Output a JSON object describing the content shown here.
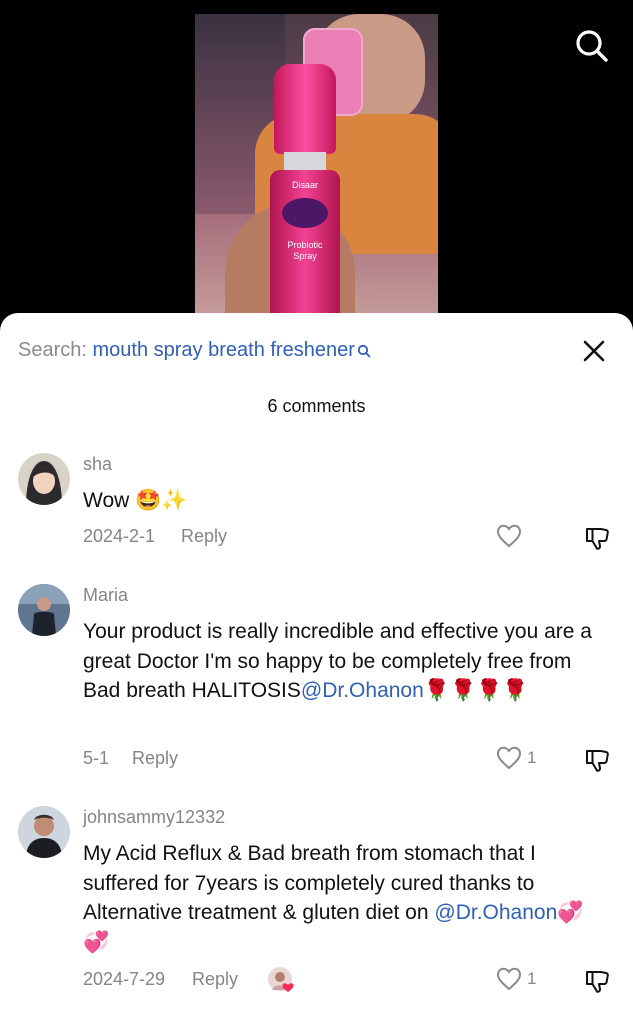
{
  "video": {
    "brand": "Disaar",
    "product_line1": "Probiotic",
    "product_line2": "Spray"
  },
  "search_bar": {
    "prefix": "Search:",
    "query": "mouth spray breath freshener"
  },
  "comments_header": {
    "count_label": "6 comments"
  },
  "comments": [
    {
      "username": "sha",
      "text": "Wow 🤩✨",
      "date": "2024-2-1",
      "reply_label": "Reply",
      "likes": ""
    },
    {
      "username": "Maria",
      "text": "Your product is really incredible and effective you are a great Doctor I'm so happy to be completely free from Bad breath HALITOSIS",
      "mention": "@Dr.Ohanon",
      "text_after": "🌹🌹🌹🌹",
      "date": "5-1",
      "reply_label": "Reply",
      "likes": "1"
    },
    {
      "username": "johnsammy12332",
      "text": "My Acid Reflux & Bad breath from stomach that I suffered for 7years is completely cured thanks to Alternative treatment & gluten diet on",
      "mention": "@Dr.Ohanon",
      "text_after": "💞 💞",
      "date": "2024-7-29",
      "reply_label": "Reply",
      "likes": "1"
    }
  ],
  "colors": {
    "mention": "#2f5fb6",
    "muted": "#858589"
  }
}
